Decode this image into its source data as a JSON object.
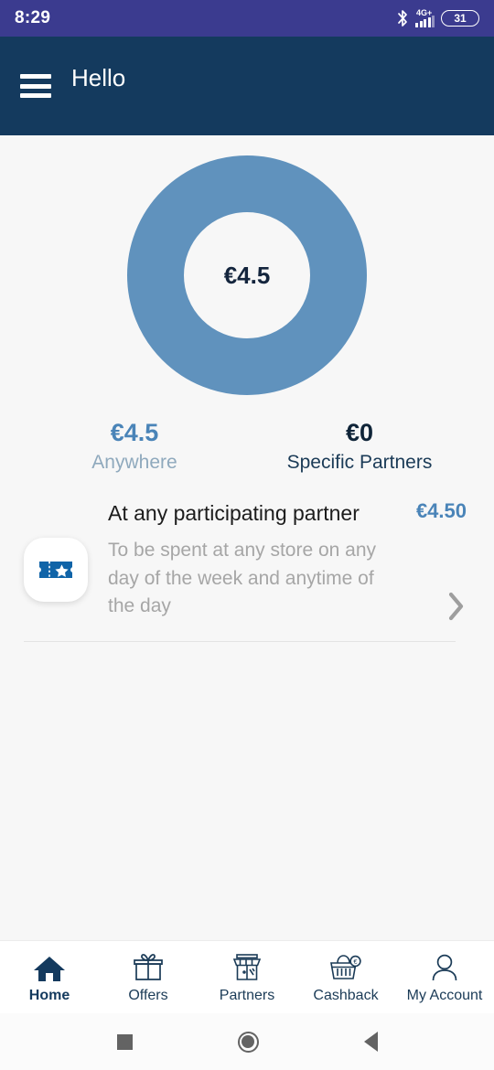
{
  "status_bar": {
    "time": "8:29",
    "battery_level": "31",
    "network_label": "4G+",
    "icons": [
      "bluetooth-icon",
      "signal-icon",
      "battery-icon"
    ]
  },
  "app_bar": {
    "greeting": "Hello",
    "menu_icon": "hamburger-menu-icon"
  },
  "chart_data": {
    "type": "pie",
    "title": "",
    "center_label": "€4.5",
    "categories": [
      "Anywhere",
      "Specific Partners"
    ],
    "values": [
      4.5,
      0
    ],
    "colors": [
      "#6092bd",
      "#e8e8e8"
    ],
    "legend_position": "below",
    "total": 4.5,
    "currency": "€"
  },
  "balance_legend": [
    {
      "value": "€4.5",
      "label": "Anywhere",
      "color": "#4a84b8"
    },
    {
      "value": "€0",
      "label": "Specific Partners",
      "color": "#0f2438"
    }
  ],
  "voucher": {
    "icon": "ticket-star-icon",
    "title": "At any participating partner",
    "description": "To be spent at any store on any day of the week and anytime of the day",
    "amount": "€4.50",
    "chevron": "chevron-right-icon"
  },
  "bottom_nav": {
    "items": [
      {
        "label": "Home",
        "icon": "home-icon",
        "active": true
      },
      {
        "label": "Offers",
        "icon": "gift-icon",
        "active": false
      },
      {
        "label": "Partners",
        "icon": "storefront-icon",
        "active": false
      },
      {
        "label": "Cashback",
        "icon": "basket-euro-icon",
        "active": false
      },
      {
        "label": "My Account",
        "icon": "person-icon",
        "active": false
      }
    ]
  },
  "system_nav": {
    "recents": "square-recents-icon",
    "home": "circle-home-icon",
    "back": "triangle-back-icon"
  },
  "theme": {
    "status_bar_bg": "#3b3b8f",
    "app_bar_bg": "#143a5e",
    "accent_blue": "#6092bd",
    "content_bg": "#f7f7f7"
  }
}
